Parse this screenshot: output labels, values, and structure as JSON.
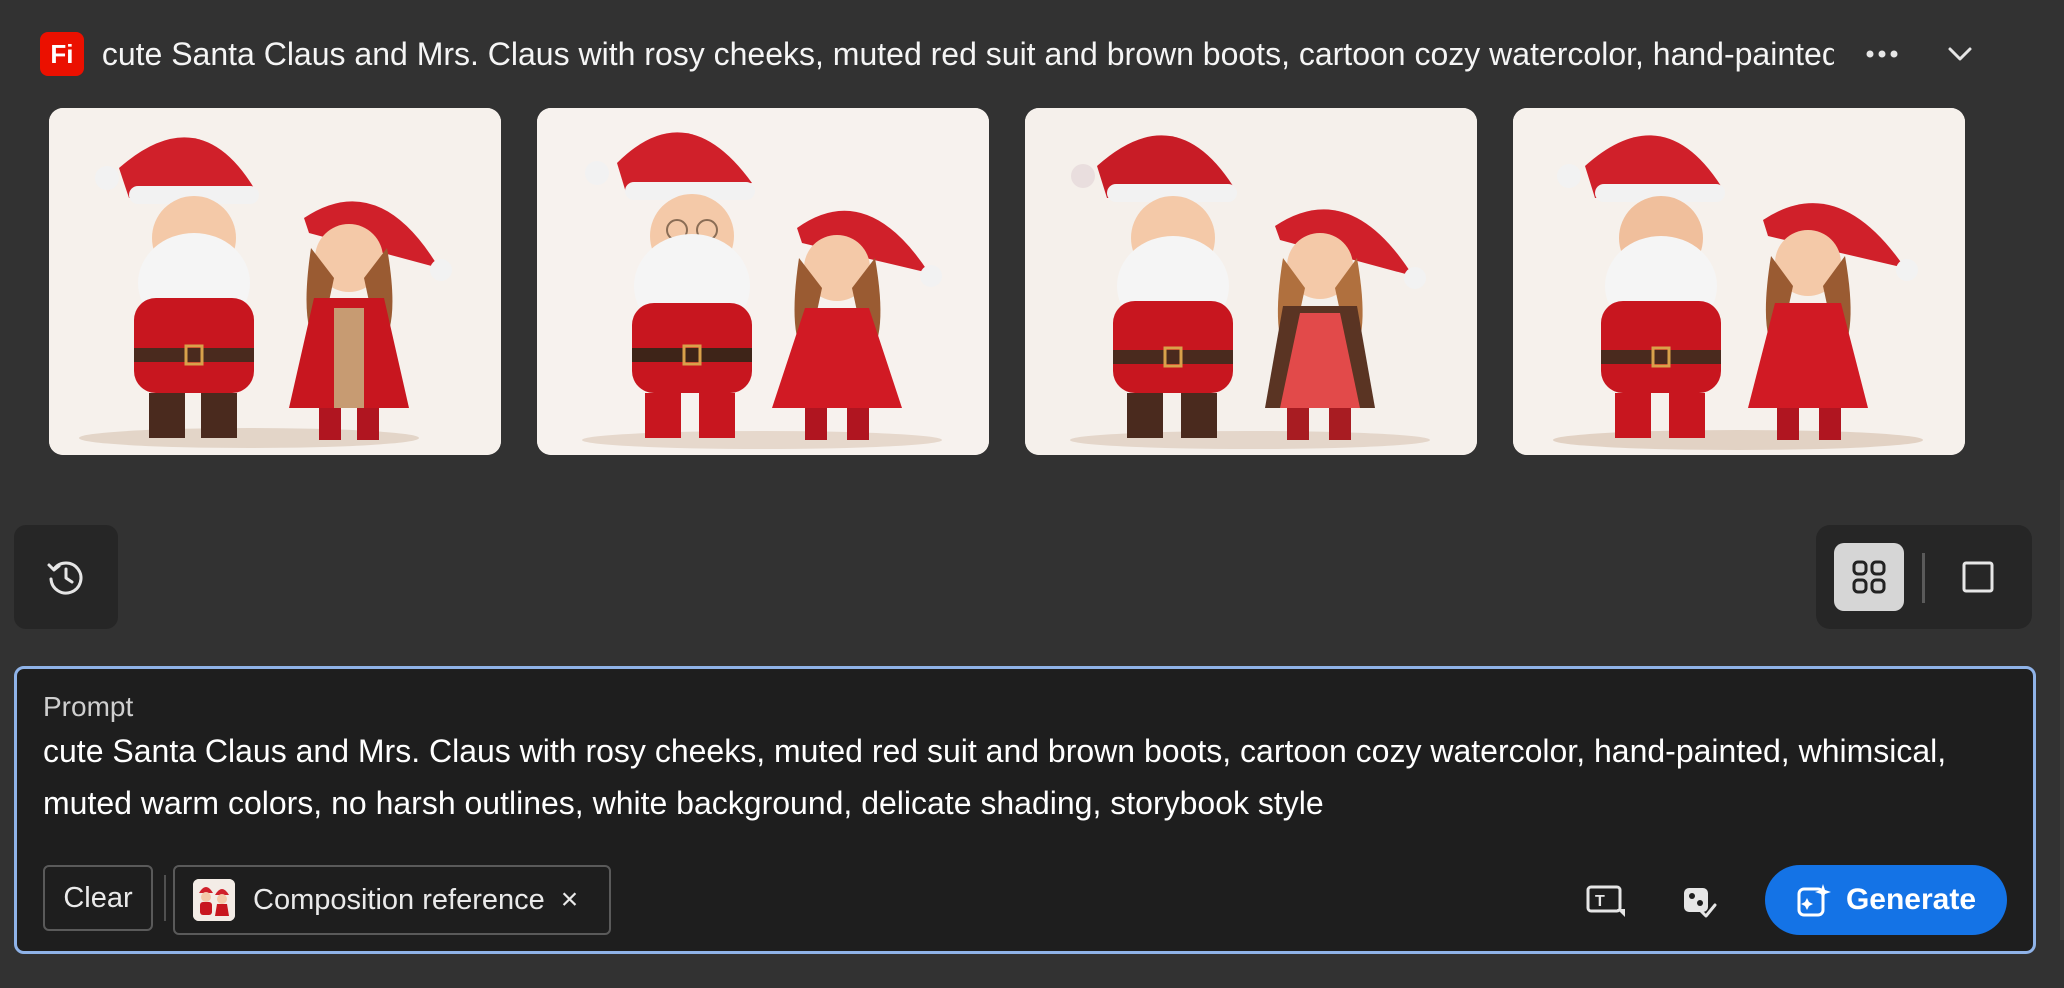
{
  "app": {
    "logo_text": "Fi",
    "brand_color": "#eb1000"
  },
  "header": {
    "title": "cute Santa Claus and Mrs. Claus with rosy cheeks, muted red suit and brown boots, cartoon cozy watercolor, hand-painted",
    "more_icon": "ellipsis-icon",
    "collapse_icon": "chevron-down-icon"
  },
  "gallery": {
    "images": [
      {
        "subject": "santa-and-mrs-claus"
      },
      {
        "subject": "santa-and-mrs-claus"
      },
      {
        "subject": "santa-and-mrs-claus"
      },
      {
        "subject": "santa-and-mrs-claus"
      }
    ]
  },
  "history": {
    "icon": "history-icon"
  },
  "layout_toggle": {
    "selected": "grid",
    "options": [
      "grid",
      "single"
    ]
  },
  "prompt": {
    "label": "Prompt",
    "text": "cute Santa Claus and Mrs. Claus with rosy cheeks, muted red suit and brown boots, cartoon cozy watercolor, hand-painted, whimsical, muted warm colors, no harsh outlines, white background, delicate shading, storybook style",
    "clear_label": "Clear",
    "reference_chip": {
      "label": "Composition reference",
      "close": "×"
    },
    "generate_label": "Generate",
    "accent_color": "#1473e6",
    "focus_border_color": "#8fb3e8"
  }
}
